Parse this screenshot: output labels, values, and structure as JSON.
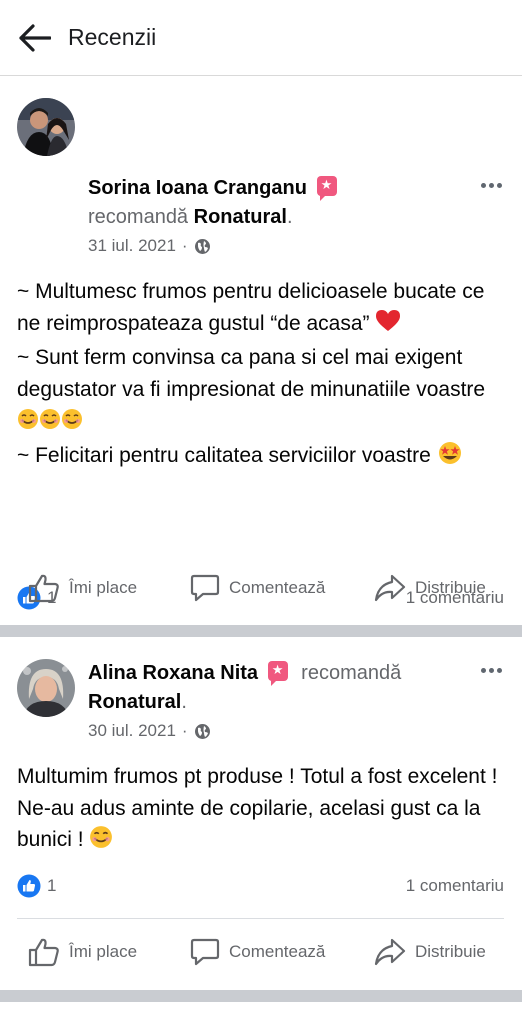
{
  "header": {
    "title": "Recenzii"
  },
  "posts": [
    {
      "author": "Sorina Ioana Cranganu",
      "verb": "recomandă",
      "page": "Ronatural",
      "date": "31 iul. 2021",
      "separator_dot": "·",
      "lines": [
        "~ Multumesc frumos pentru delicioasele bucate ce ne reimprospateaza gustul “de acasa”",
        "~ Sunt ferm convinsa ca pana si cel mai exigent degustator va fi impresionat de minunatiile voastre",
        "~ Felicitari pentru calitatea serviciilor voastre"
      ],
      "likes": "1",
      "comments": "1 comentariu"
    },
    {
      "author": "Alina Roxana Nita",
      "verb": "recomandă",
      "page": "Ronatural",
      "date": "30 iul. 2021",
      "separator_dot": "·",
      "lines": [
        "Multumim frumos pt produse ! Totul a fost excelent ! Ne-au adus aminte de copilarie, acelasi gust ca la bunici !"
      ],
      "likes": "1",
      "comments": "1 comentariu"
    }
  ],
  "actions": {
    "like": "Îmi place",
    "comment": "Comentează",
    "share": "Distribuie"
  },
  "icons": {
    "back": "arrow-left-icon",
    "more": "more-horizontal-icon",
    "badge": "recommend-star-icon",
    "globe": "globe-icon",
    "like_reaction": "thumbs-up-reaction-icon",
    "like": "thumbs-up-icon",
    "comment": "comment-bubble-icon",
    "share": "share-arrow-icon",
    "emoji_heart": "red-heart-emoji",
    "emoji_smile": "smiling-face-emoji",
    "emoji_starstruck": "star-struck-emoji"
  },
  "colors": {
    "reaction_blue": "#1877f2",
    "badge_pink": "#f0587f",
    "separator": "#c9ccd1",
    "secondary_text": "#65676b"
  }
}
